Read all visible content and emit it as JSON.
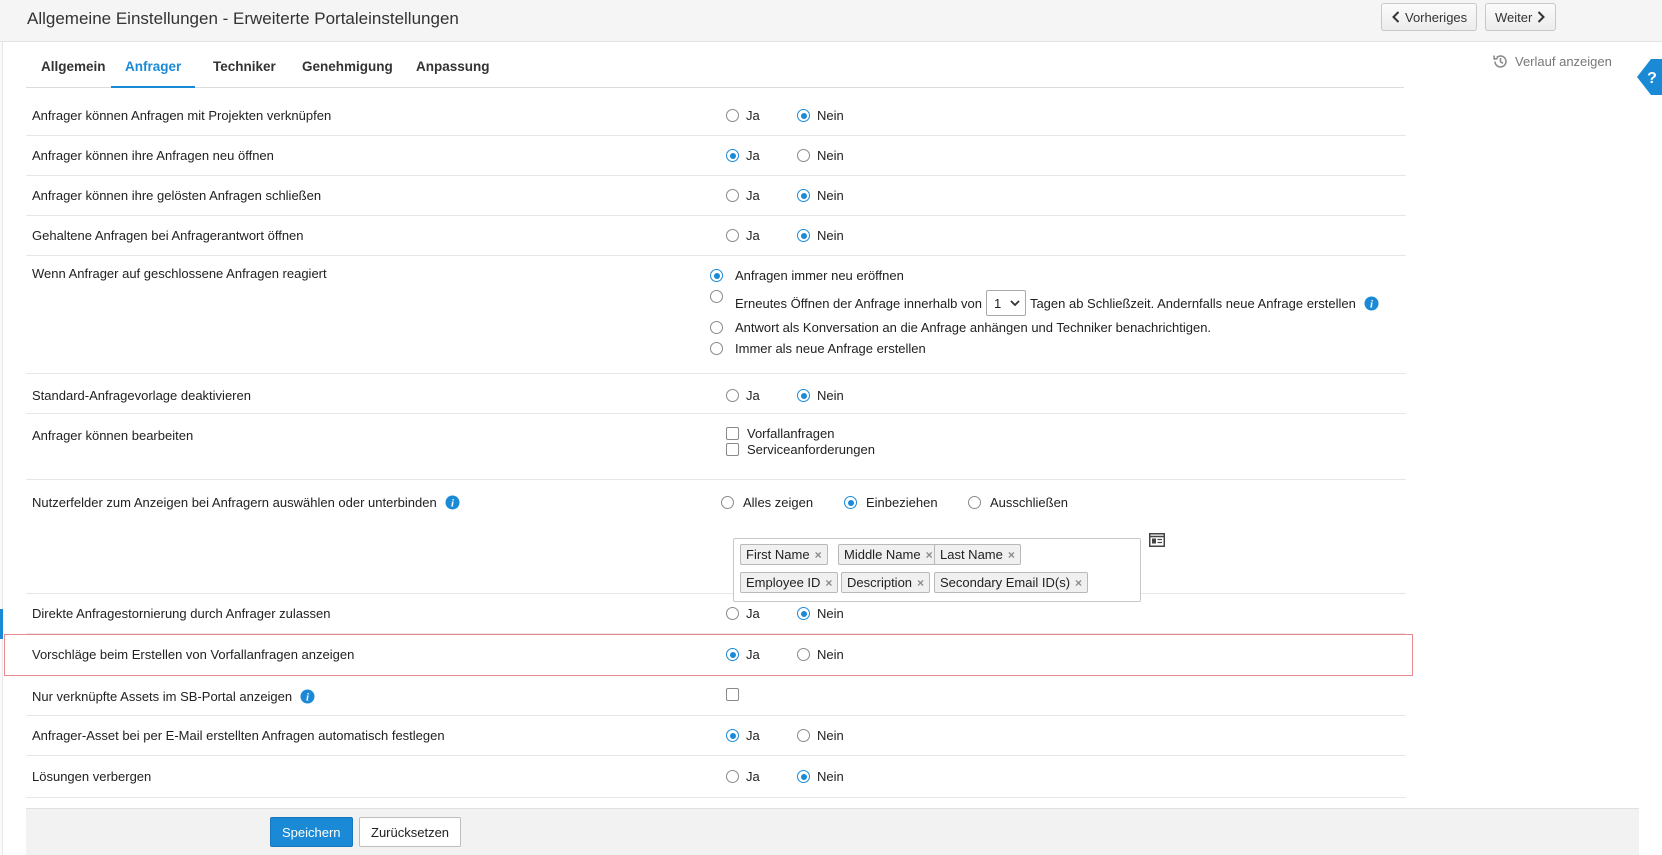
{
  "header": {
    "title": "Allgemeine Einstellungen - Erweiterte Portaleinstellungen",
    "prev_label": "Vorheriges",
    "next_label": "Weiter"
  },
  "tabs": [
    "Allgemein",
    "Anfrager",
    "Techniker",
    "Genehmigung",
    "Anpassung"
  ],
  "active_tab": "Anfrager",
  "history_label": "Verlauf anzeigen",
  "options": {
    "yes": "Ja",
    "no": "Nein"
  },
  "settings": [
    {
      "label": "Anfrager können Anfragen mit Projekten verknüpfen",
      "value": "Nein"
    },
    {
      "label": "Anfrager können ihre Anfragen neu öffnen",
      "value": "Ja"
    },
    {
      "label": "Anfrager können ihre gelösten Anfragen schließen",
      "value": "Nein"
    },
    {
      "label": "Gehaltene Anfragen bei Anfragerantwort öffnen",
      "value": "Nein"
    },
    {
      "label": "Wenn Anfrager auf geschlossene Anfragen reagiert",
      "choices": {
        "always_reopen": "Anfragen immer neu eröffnen",
        "reopen_within_prefix": "Erneutes Öffnen der Anfrage innerhalb von",
        "reopen_days": "1",
        "reopen_within_suffix": "Tagen ab Schließzeit. Andernfalls neue Anfrage erstellen",
        "append_conversation": "Antwort als Konversation an die Anfrage anhängen und Techniker benachrichtigen.",
        "always_new": "Immer als neue Anfrage erstellen"
      },
      "selected": "Anfragen immer neu eröffnen"
    },
    {
      "label": "Standard-Anfragevorlage deaktivieren",
      "value": "Nein"
    },
    {
      "label": "Anfrager können bearbeiten",
      "checkboxes": [
        "Vorfallanfragen",
        "Serviceanforderungen"
      ],
      "checked": []
    },
    {
      "label": "Nutzerfelder zum Anzeigen bei Anfragern auswählen oder unterbinden",
      "choices": [
        "Alles zeigen",
        "Einbeziehen",
        "Ausschließen"
      ],
      "selected": "Einbeziehen",
      "fields": [
        "First Name",
        "Middle Name",
        "Last Name",
        "Employee ID",
        "Description",
        "Secondary Email ID(s)"
      ]
    },
    {
      "label": "Direkte Anfragestornierung durch Anfrager zulassen",
      "value": "Nein"
    },
    {
      "label": "Vorschläge beim Erstellen von Vorfallanfragen anzeigen",
      "value": "Ja"
    },
    {
      "label": "Nur verknüpfte Assets im SB-Portal anzeigen",
      "checked": false
    },
    {
      "label": "Anfrager-Asset bei per E-Mail erstellten Anfragen automatisch festlegen",
      "value": "Ja"
    },
    {
      "label": "Lösungen verbergen",
      "value": "Nein"
    }
  ],
  "footer": {
    "save_label": "Speichern",
    "reset_label": "Zurücksetzen"
  },
  "colors": {
    "accent": "#1a8ad6",
    "highlight_border": "#e88a8f"
  }
}
